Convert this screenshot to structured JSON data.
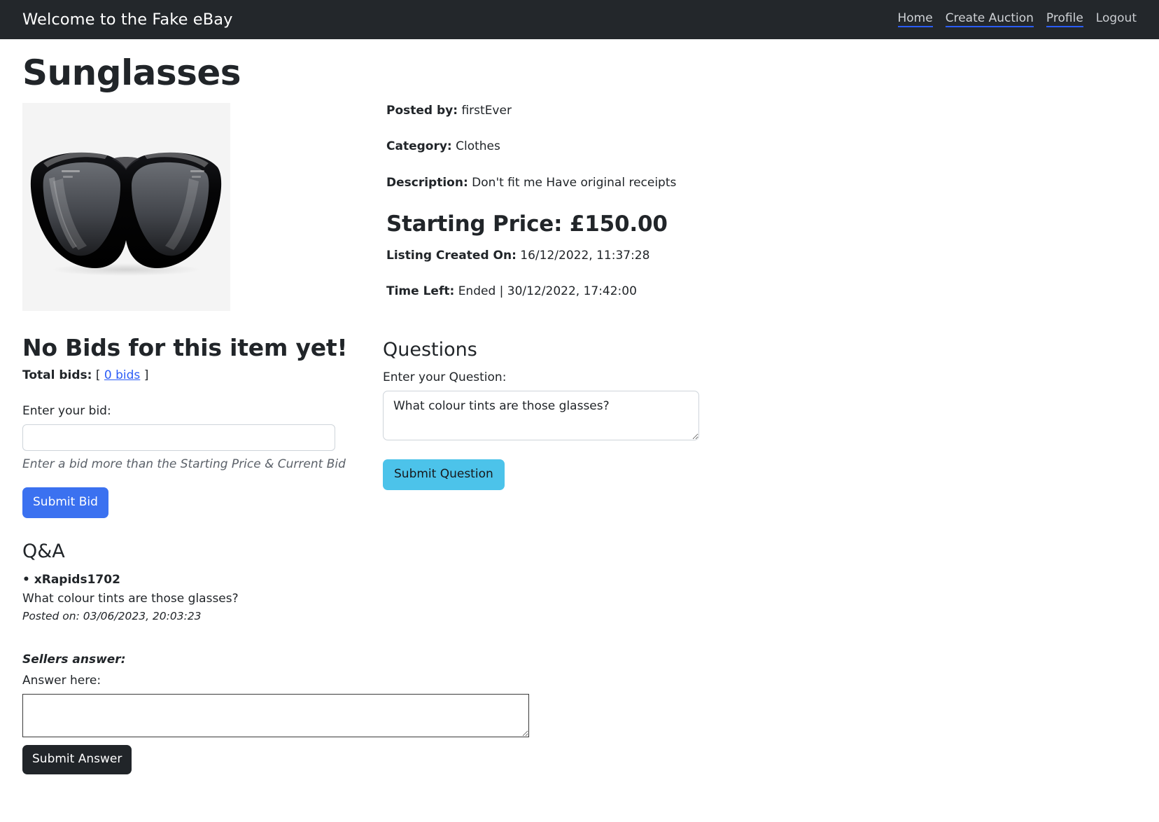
{
  "navbar": {
    "brand": "Welcome to the Fake eBay",
    "links": [
      {
        "label": "Home",
        "underlined": true
      },
      {
        "label": "Create Auction",
        "underlined": true
      },
      {
        "label": "Profile",
        "underlined": true
      },
      {
        "label": "Logout",
        "underlined": false
      }
    ]
  },
  "listing": {
    "title": "Sunglasses",
    "image_alt": "black cat-eye sunglasses on light grey background",
    "posted_by_label": "Posted by:",
    "posted_by_value": "firstEver",
    "category_label": "Category:",
    "category_value": "Clothes",
    "description_label": "Description:",
    "description_value": "Don't fit me Have original receipts",
    "price_label": "Starting Price:",
    "price_value": "£150.00",
    "created_label": "Listing Created On:",
    "created_value": "16/12/2022, 11:37:28",
    "time_left_label": "Time Left:",
    "time_left_value": "Ended | 30/12/2022, 17:42:00"
  },
  "bids": {
    "heading": "No Bids for this item yet!",
    "total_label": "Total bids:",
    "bracket_open": "[",
    "count_link": "0 bids",
    "bracket_close": "]",
    "bid_field_label": "Enter your bid:",
    "bid_field_value": "",
    "bid_field_placeholder": "",
    "hint": "Enter a bid more than the Starting Price & Current Bid",
    "submit_label": "Submit Bid"
  },
  "questions": {
    "heading": "Questions",
    "field_label": "Enter your Question:",
    "field_value": "What colour tints are those glasses?",
    "field_placeholder": "",
    "submit_label": "Submit Question"
  },
  "qa": {
    "heading": "Q&A",
    "entries": [
      {
        "user": "• xRapids1702",
        "question": "What colour tints are those glasses?",
        "posted": "Posted on: 03/06/2023, 20:03:23"
      }
    ],
    "sellers_answer_label": "Sellers answer:",
    "answer_field_label": "Answer here:",
    "answer_field_value": "",
    "answer_field_placeholder": "",
    "submit_label": "Submit Answer"
  },
  "colors": {
    "navbar_bg": "#23272b",
    "link_blue": "#2b5cf6",
    "primary_button": "#3b71f0",
    "info_button": "#4cc3ea",
    "dark_button": "#212529",
    "image_bg": "#f4f4f4"
  }
}
